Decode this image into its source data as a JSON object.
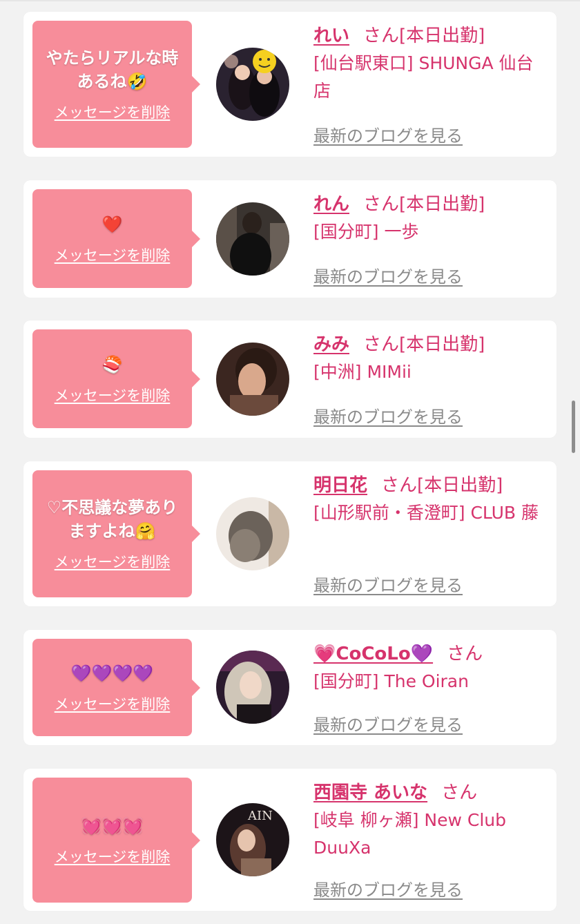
{
  "common": {
    "delete_label": "メッセージを削除",
    "blog_label": "最新のブログを見る",
    "honorific": "さん",
    "accent_color": "#d6336c",
    "bubble_color": "#f78d9a"
  },
  "cards": [
    {
      "message": "やたらリアルな時あるね🤣",
      "name": "れい",
      "status": "[本日出勤]",
      "shop": "[仙台駅東口] SHUNGA 仙台店"
    },
    {
      "message": "❤️",
      "name": "れん",
      "status": "[本日出勤]",
      "shop": "[国分町] 一歩"
    },
    {
      "message": "🍣",
      "name": "みみ",
      "status": "[本日出勤]",
      "shop": "[中洲] MIMii"
    },
    {
      "message": "♡不思議な夢ありますよね🤗",
      "name": "明日花",
      "status": "[本日出勤]",
      "shop": "[山形駅前・香澄町] CLUB 藤"
    },
    {
      "message": "💜💜💜💜",
      "name": "💗CoCoLo💜",
      "status": "",
      "shop": "[国分町] The Oiran"
    },
    {
      "message": "💓💓💓",
      "name": "西園寺 あいな",
      "status": "",
      "shop": "[岐阜 柳ヶ瀬] New Club DuuXa"
    }
  ]
}
